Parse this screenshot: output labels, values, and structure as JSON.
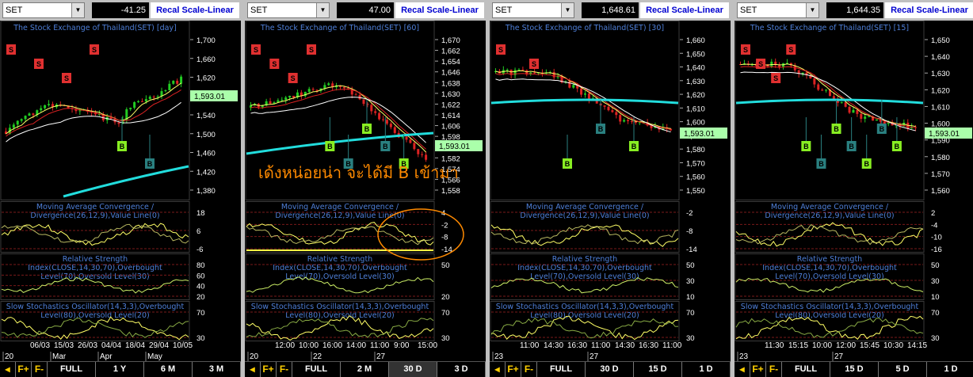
{
  "panes": [
    {
      "symbol": "SET",
      "value": "-41.25",
      "scale": "Recal Scale-Linear",
      "title": "The Stock Exchange of Thailand(SET) [day]",
      "last_price": "1,593.01",
      "price_ticks": [
        "1,700",
        "1,660",
        "1,620",
        "1,580",
        "1,540",
        "1,500",
        "1,460",
        "1,420",
        "1,380"
      ],
      "macd_ticks": [
        "18",
        "6",
        "-6"
      ],
      "rsi_ticks": [
        "80",
        "60",
        "40",
        "20"
      ],
      "sto_ticks": [
        "70",
        "30"
      ],
      "dates": [
        "06/03",
        "15/03",
        "26/03",
        "04/04",
        "18/04",
        "29/04",
        "10/05"
      ],
      "months": [
        "20",
        "Mar",
        "Apr",
        "May"
      ],
      "signals": [
        "S",
        "S",
        "S",
        "S",
        "B",
        "B"
      ],
      "buttons": [
        "FULL",
        "1 Y",
        "6 M",
        "3 M"
      ]
    },
    {
      "symbol": "SET",
      "value": "47.00",
      "scale": "Recal Scale-Linear",
      "title": "The Stock Exchange of Thailand(SET) [60]",
      "last_price": "1,593.01",
      "price_ticks": [
        "1,670",
        "1,662",
        "1,654",
        "1,646",
        "1,638",
        "1,630",
        "1,622",
        "1,614",
        "1,606",
        "1,598",
        "1,590",
        "1,582",
        "1,574",
        "1,566",
        "1,558"
      ],
      "macd_ticks": [
        "4",
        "-2",
        "-8",
        "-14"
      ],
      "rsi_ticks": [
        "50",
        "20"
      ],
      "sto_ticks": [
        "70",
        "30"
      ],
      "dates": [
        "12:00",
        "10:00",
        "16:00",
        "14:00",
        "11:00",
        "9:00",
        "15:00"
      ],
      "months": [
        "20",
        "22",
        "27"
      ],
      "signals": [
        "S",
        "S",
        "S",
        "S",
        "B",
        "B",
        "B",
        "B",
        "B"
      ],
      "buttons": [
        "FULL",
        "2 M",
        "30 D",
        "3 D"
      ]
    },
    {
      "symbol": "SET",
      "value": "1,648.61",
      "scale": "Recal Scale-Linear",
      "title": "The Stock Exchange of Thailand(SET) [30]",
      "last_price": "1,593.01",
      "price_ticks": [
        "1,660",
        "1,650",
        "1,640",
        "1,630",
        "1,620",
        "1,610",
        "1,600",
        "1,590",
        "1,580",
        "1,570",
        "1,560",
        "1,550"
      ],
      "macd_ticks": [
        "-2",
        "-8",
        "-14"
      ],
      "rsi_ticks": [
        "50",
        "30",
        "10"
      ],
      "sto_ticks": [
        "70",
        "30"
      ],
      "dates": [
        "11:00",
        "14:30",
        "16:30",
        "11:00",
        "14:30",
        "16:30",
        "11:00"
      ],
      "months": [
        "23",
        "27"
      ],
      "signals": [
        "S",
        "S",
        "B",
        "B",
        "B"
      ],
      "buttons": [
        "FULL",
        "30 D",
        "15 D",
        "1 D"
      ]
    },
    {
      "symbol": "SET",
      "value": "1,644.35",
      "scale": "Recal Scale-Linear",
      "title": "The Stock Exchange of Thailand(SET) [15]",
      "last_price": "1,593.01",
      "price_ticks": [
        "1,650",
        "1,640",
        "1,630",
        "1,620",
        "1,610",
        "1,600",
        "1,590",
        "1,580",
        "1,570",
        "1,560"
      ],
      "macd_ticks": [
        "2",
        "-4",
        "-10",
        "-16"
      ],
      "rsi_ticks": [
        "50",
        "30",
        "10"
      ],
      "sto_ticks": [
        "70",
        "30"
      ],
      "dates": [
        "11:30",
        "15:15",
        "10:00",
        "12:00",
        "15:45",
        "10:30",
        "14:15"
      ],
      "months": [
        "23",
        "27"
      ],
      "signals": [
        "S",
        "S",
        "S",
        "S",
        "B",
        "B",
        "B",
        "B",
        "B",
        "B",
        "B"
      ],
      "buttons": [
        "FULL",
        "15 D",
        "5 D",
        "1 D"
      ]
    }
  ],
  "indicator_titles": {
    "macd": [
      "Moving Average Convergence /",
      "Divergence(26,12,9),Value Line(0)"
    ],
    "rsi": [
      "Relative Strength",
      "Index(CLOSE,14,30,70),Overbought",
      "Level(70),Oversold Level(30)"
    ],
    "sto": [
      "Slow Stochastics Oscillator(14,3,3),Overbought",
      "Level(80),Oversold Level(20)"
    ]
  },
  "nav_buttons": [
    "F+",
    "F-"
  ],
  "annotation": "เด้งหน่อยน่า จะได้มี B เข้ามา",
  "colors": {
    "candle_up": "#22cc22",
    "candle_down": "#dd2222",
    "ma_long": "#22dddd",
    "ma_mid": "#ffffff",
    "ma_short": "#ffff66",
    "sell_tag": "#e03030",
    "buy_tag": "#2a8080",
    "annotation": "#ff8a00",
    "panel_title": "#4e7fd8"
  }
}
